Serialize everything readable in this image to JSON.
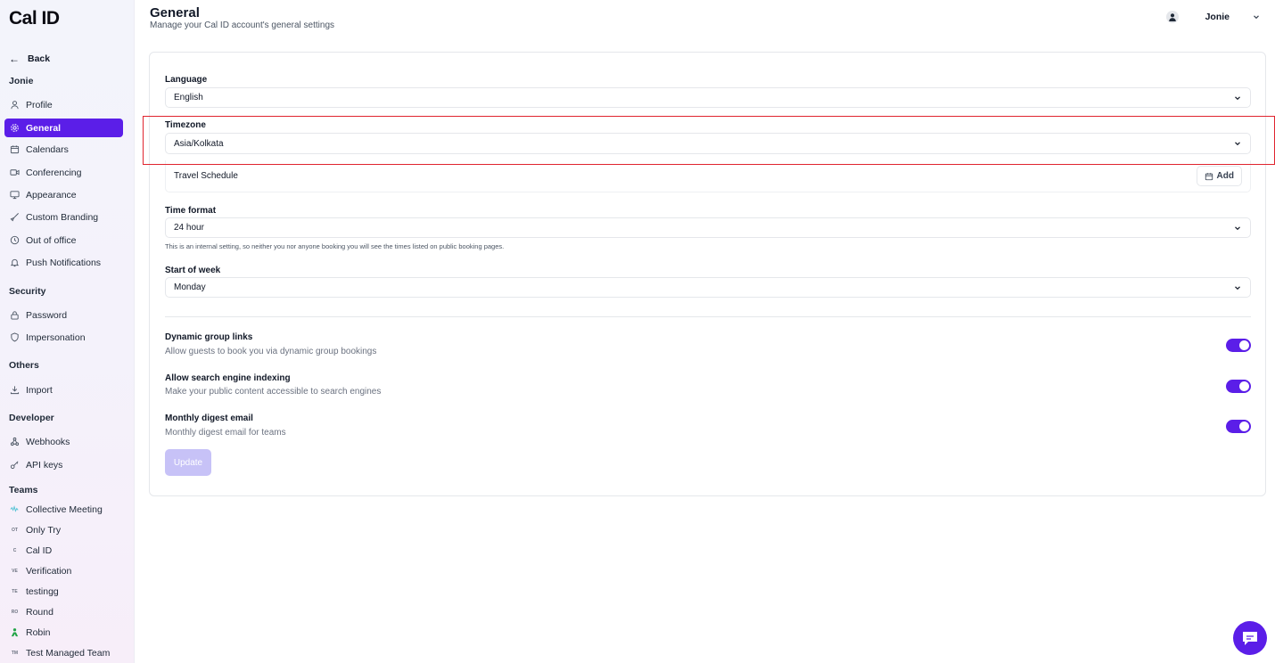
{
  "app": {
    "logo": "Cal ID"
  },
  "sidebar": {
    "back_label": "Back",
    "user_section": "Jonie",
    "items": [
      {
        "label": "Profile",
        "icon": "user-icon"
      },
      {
        "label": "General",
        "icon": "gear-icon",
        "active": true
      },
      {
        "label": "Calendars",
        "icon": "calendar-icon"
      },
      {
        "label": "Conferencing",
        "icon": "video-icon"
      },
      {
        "label": "Appearance",
        "icon": "monitor-icon"
      },
      {
        "label": "Custom Branding",
        "icon": "brush-icon"
      },
      {
        "label": "Out of office",
        "icon": "clock-icon"
      },
      {
        "label": "Push Notifications",
        "icon": "bell-icon"
      }
    ],
    "security_title": "Security",
    "security_items": [
      {
        "label": "Password",
        "icon": "lock-icon"
      },
      {
        "label": "Impersonation",
        "icon": "shield-icon"
      }
    ],
    "others_title": "Others",
    "others_items": [
      {
        "label": "Import",
        "icon": "download-icon"
      }
    ],
    "developer_title": "Developer",
    "developer_items": [
      {
        "label": "Webhooks",
        "icon": "webhook-icon"
      },
      {
        "label": "API keys",
        "icon": "key-icon"
      }
    ],
    "teams_title": "Teams",
    "teams": [
      {
        "label": "Collective Meeting",
        "badge": ""
      },
      {
        "label": "Only Try",
        "badge": "OT"
      },
      {
        "label": "Cal ID",
        "badge": "C"
      },
      {
        "label": "Verification",
        "badge": "VE"
      },
      {
        "label": "testingg",
        "badge": "TE"
      },
      {
        "label": "Round",
        "badge": "RO"
      },
      {
        "label": "Robin",
        "badge": ""
      },
      {
        "label": "Test Managed Team",
        "badge": "TM"
      }
    ]
  },
  "header": {
    "title": "General",
    "subtitle": "Manage your Cal ID account's general settings",
    "user_name": "Jonie"
  },
  "form": {
    "language_label": "Language",
    "language_value": "English",
    "timezone_label": "Timezone",
    "timezone_value": "Asia/Kolkata",
    "travel_schedule_label": "Travel Schedule",
    "add_label": "Add",
    "time_format_label": "Time format",
    "time_format_value": "24 hour",
    "time_format_hint": "This is an internal setting, so neither you nor anyone booking you will see the times listed on public booking pages.",
    "start_of_week_label": "Start of week",
    "start_of_week_value": "Monday",
    "toggles": [
      {
        "title": "Dynamic group links",
        "description": "Allow guests to book you via dynamic group bookings",
        "on": true
      },
      {
        "title": "Allow search engine indexing",
        "description": "Make your public content accessible to search engines",
        "on": true
      },
      {
        "title": "Monthly digest email",
        "description": "Monthly digest email for teams",
        "on": true
      }
    ],
    "update_label": "Update"
  },
  "colors": {
    "accent": "#5b1ee8",
    "highlight": "#e0242f"
  }
}
